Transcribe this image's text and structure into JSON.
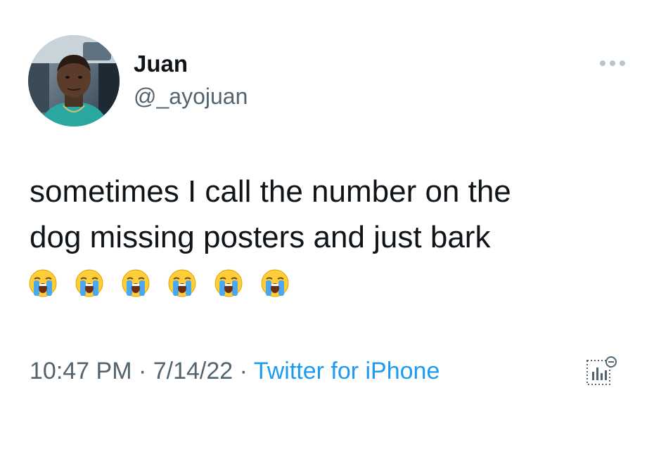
{
  "tweet": {
    "author_name": "Juan",
    "author_handle": "@_ayojuan",
    "text_line1": "sometimes I call the number on the",
    "text_line2": "dog missing posters and just bark",
    "emoji_count": 6,
    "emoji_name": "loudly-crying-face-icon",
    "time": "10:47 PM",
    "separator1": " · ",
    "date": "7/14/22",
    "separator2": " · ",
    "source": "Twitter for iPhone"
  },
  "icons": {
    "more": "more-options-icon",
    "analytics": "tweet-analytics-icon"
  },
  "colors": {
    "text": "#0f1419",
    "secondary": "#536471",
    "link": "#1d9bf0"
  }
}
